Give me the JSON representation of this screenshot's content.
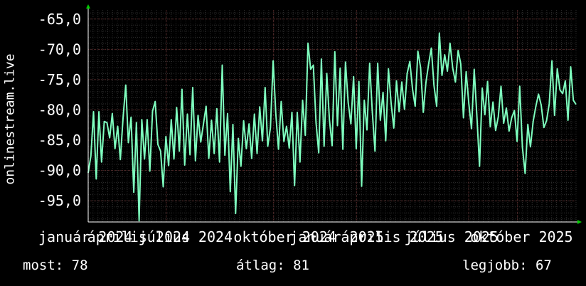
{
  "chart_data": {
    "type": "line",
    "ylabel": "onlinestream.live",
    "ylim": [
      -98.5,
      -63.5
    ],
    "yticks": [
      -65,
      -70,
      -75,
      -80,
      -85,
      -90,
      -95
    ],
    "ytick_labels": [
      "-65,0",
      "-70,0",
      "-75,0",
      "-80,0",
      "-85,0",
      "-90,0",
      "-95,0"
    ],
    "xlim": [
      0,
      100
    ],
    "xtick_positions": [
      16,
      38,
      55,
      78,
      88,
      104
    ],
    "xtick_labels": [
      "január 2024",
      "április 2024",
      "július 2024",
      "október 2024",
      "január 2025",
      "április 2025",
      "július 2025",
      "október 2025"
    ],
    "xtick_label_positions": [
      0,
      10,
      20.5,
      40,
      51.5,
      62,
      75,
      88.5
    ],
    "grid": true,
    "colors": {
      "line": "#7fffbf",
      "grid_major": "#5a2a2a",
      "grid_minor": "#2e2e2e",
      "axis": "#ffffff",
      "arrow": "#00cc00",
      "background": "#000000"
    },
    "series": [
      {
        "values": [
          -90.4,
          -87.6,
          -80.3,
          -91.4,
          -80.3,
          -88.6,
          -81.9,
          -82.1,
          -84.6,
          -80.6,
          -86.4,
          -82.7,
          -88.2,
          -81.4,
          -75.9,
          -85.4,
          -81.2,
          -93.6,
          -82.1,
          -98.3,
          -81.6,
          -88.1,
          -81.6,
          -90.1,
          -80.2,
          -78.6,
          -85.7,
          -86.8,
          -92.7,
          -84.4,
          -89.2,
          -81.6,
          -88.1,
          -79.6,
          -86.8,
          -76.6,
          -89.1,
          -80.7,
          -87.4,
          -76.3,
          -88.4,
          -80.9,
          -85.3,
          -82.3,
          -79.4,
          -88.0,
          -81.7,
          -87.2,
          -79.8,
          -88.6,
          -72.6,
          -87.5,
          -80.6,
          -93.5,
          -82.4,
          -97.1,
          -84.7,
          -89.3,
          -81.8,
          -86.4,
          -82.3,
          -88.0,
          -80.7,
          -87.2,
          -79.5,
          -85.1,
          -76.3,
          -86.0,
          -82.9,
          -71.9,
          -80.6,
          -86.5,
          -78.6,
          -85.2,
          -82.7,
          -86.3,
          -80.4,
          -92.5,
          -80.4,
          -88.6,
          -78.4,
          -84.2,
          -69.0,
          -73.3,
          -72.6,
          -82.1,
          -87.1,
          -71.6,
          -86.0,
          -74.0,
          -81.6,
          -85.9,
          -70.4,
          -82.6,
          -73.1,
          -86.5,
          -72.1,
          -78.8,
          -82.3,
          -74.5,
          -86.4,
          -75.3,
          -92.6,
          -78.4,
          -83.3,
          -72.3,
          -80.3,
          -86.8,
          -72.3,
          -81.7,
          -77.1,
          -85.1,
          -73.2,
          -78.8,
          -83.0,
          -75.2,
          -80.3,
          -75.4,
          -79.9,
          -74.0,
          -72.0,
          -76.6,
          -79.4,
          -70.3,
          -73.0,
          -80.4,
          -75.5,
          -72.4,
          -69.8,
          -75.9,
          -79.4,
          -67.3,
          -74.3,
          -70.9,
          -73.6,
          -69.0,
          -73.1,
          -75.4,
          -70.2,
          -72.4,
          -81.3,
          -73.7,
          -78.9,
          -83.1,
          -73.3,
          -80.9,
          -89.3,
          -76.4,
          -80.8,
          -75.3,
          -82.8,
          -78.7,
          -83.4,
          -81.1,
          -76.1,
          -82.2,
          -79.7,
          -83.5,
          -81.3,
          -80.1,
          -85.2,
          -76.1,
          -86.2,
          -90.5,
          -82.4,
          -86.1,
          -81.9,
          -79.4,
          -77.4,
          -79.2,
          -82.9,
          -81.8,
          -79.0,
          -71.9,
          -80.9,
          -73.2,
          -76.7,
          -77.3,
          -75.2,
          -81.7,
          -72.9,
          -78.4,
          -79.1
        ]
      }
    ]
  },
  "stats": {
    "most": "most: 78",
    "avg": "átlag: 81",
    "best": "legjobb: 67"
  }
}
